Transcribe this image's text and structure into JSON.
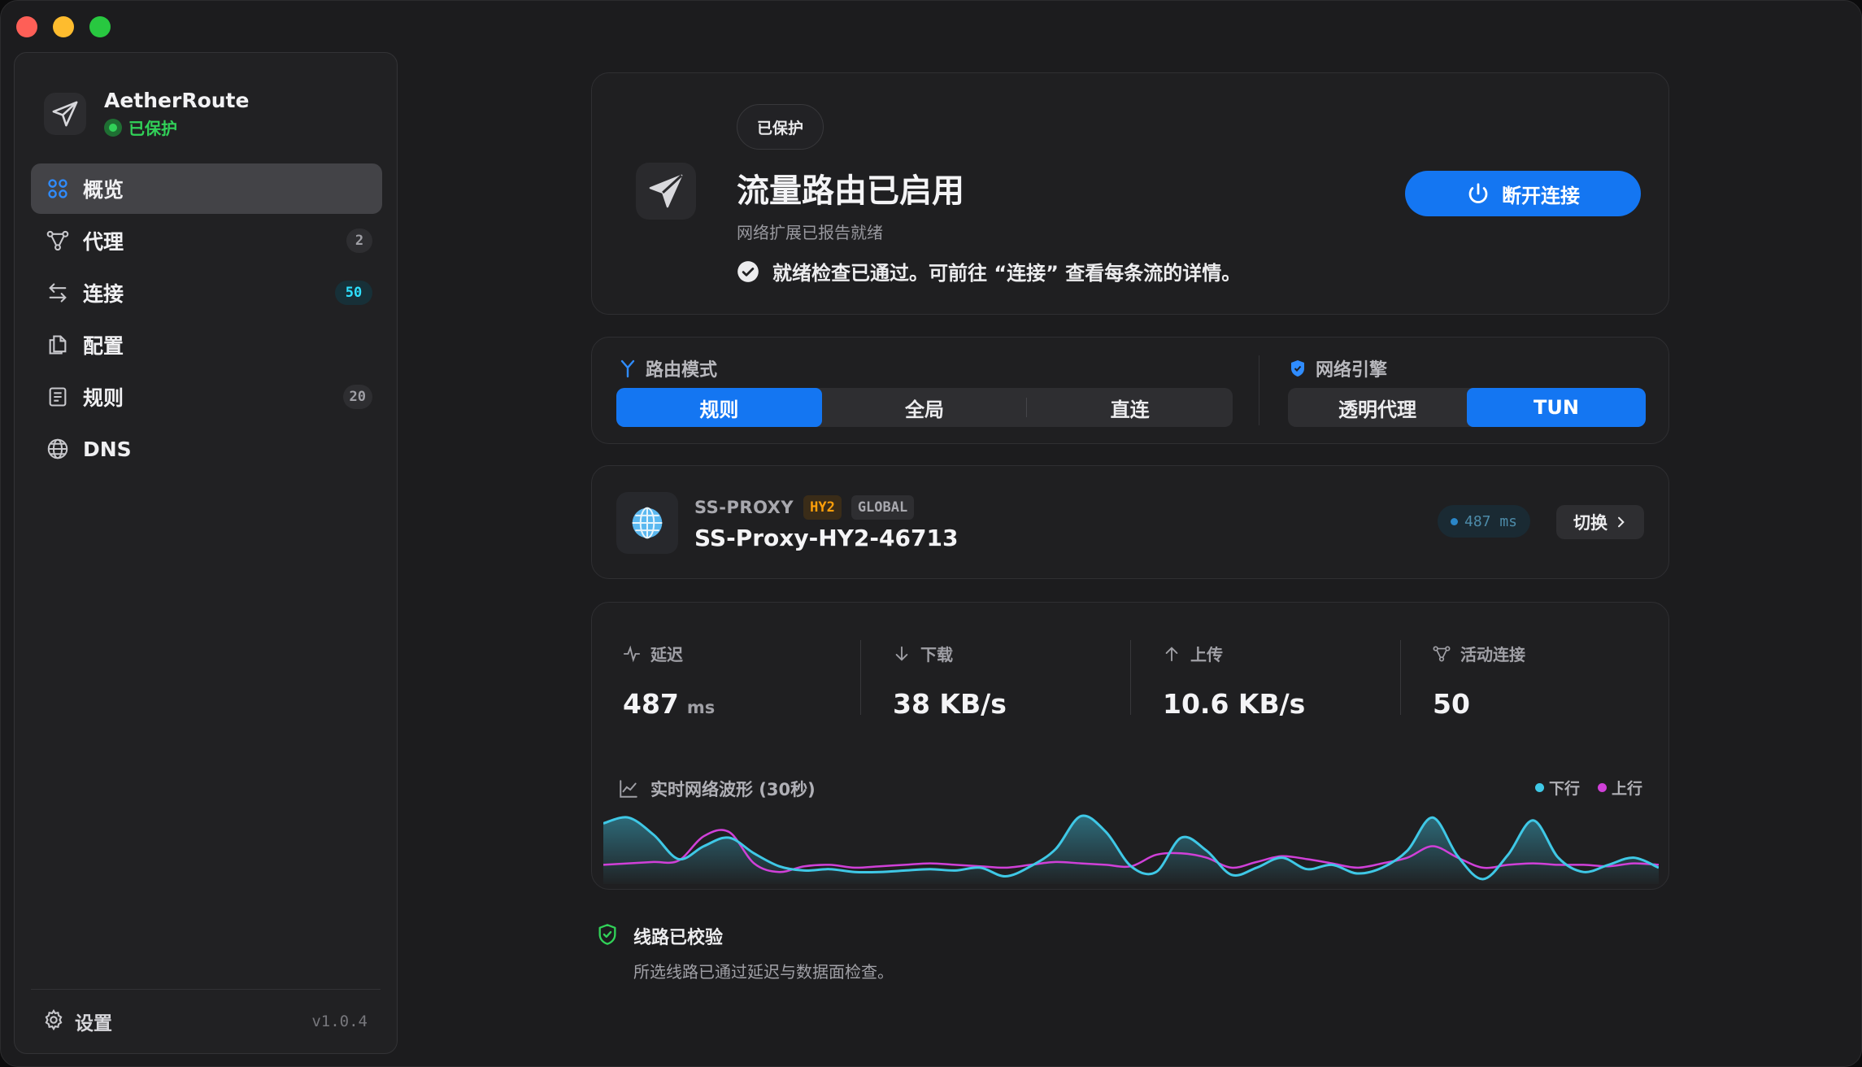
{
  "app": {
    "name": "AetherRoute",
    "status": "已保护",
    "version": "v1.0.4"
  },
  "sidebar": {
    "items": [
      {
        "label": "概览",
        "icon": "grid-icon",
        "badge": null,
        "active": true
      },
      {
        "label": "代理",
        "icon": "nodes-icon",
        "badge": "2"
      },
      {
        "label": "连接",
        "icon": "arrows-swap-icon",
        "badge": "50"
      },
      {
        "label": "配置",
        "icon": "files-icon",
        "badge": null
      },
      {
        "label": "规则",
        "icon": "list-icon",
        "badge": "20"
      },
      {
        "label": "DNS",
        "icon": "globe-icon",
        "badge": null
      }
    ],
    "settings_label": "设置"
  },
  "hero": {
    "pill": "已保护",
    "title": "流量路由已启用",
    "subtitle": "网络扩展已报告就绪",
    "check_text": "就绪检查已通过。可前往 “连接” 查看每条流的详情。",
    "disconnect_label": "断开连接"
  },
  "modes": {
    "routing_label": "路由模式",
    "routing_options": [
      "规则",
      "全局",
      "直连"
    ],
    "routing_selected": "规则",
    "engine_label": "网络引擎",
    "engine_options": [
      "透明代理",
      "TUN"
    ],
    "engine_selected": "TUN"
  },
  "proxy": {
    "type": "SS-PROXY",
    "tag_protocol": "HY2",
    "tag_scope": "GLOBAL",
    "name": "SS-Proxy-HY2-46713",
    "latency": "487 ms",
    "switch_label": "切换"
  },
  "stats": {
    "latency": {
      "label": "延迟",
      "value": "487",
      "unit": "ms"
    },
    "download": {
      "label": "下载",
      "value": "38 KB/s"
    },
    "upload": {
      "label": "上传",
      "value": "10.6 KB/s"
    },
    "connections": {
      "label": "活动连接",
      "value": "50"
    }
  },
  "wave": {
    "title": "实时网络波形 (30秒)",
    "legend_down": "下行",
    "legend_up": "上行",
    "color_down": "#3fc8e6",
    "color_up": "#d040d8",
    "down": [
      0.78,
      0.86,
      0.62,
      0.28,
      0.46,
      0.58,
      0.36,
      0.18,
      0.12,
      0.14,
      0.1,
      0.1,
      0.12,
      0.14,
      0.12,
      0.16,
      0.04,
      0.18,
      0.42,
      0.88,
      0.66,
      0.18,
      0.1,
      0.58,
      0.4,
      0.06,
      0.16,
      0.3,
      0.14,
      0.2,
      0.08,
      0.16,
      0.4,
      0.86,
      0.32,
      0.0,
      0.34,
      0.82,
      0.3,
      0.1,
      0.2,
      0.3,
      0.16
    ],
    "up": [
      0.2,
      0.22,
      0.24,
      0.26,
      0.6,
      0.66,
      0.22,
      0.1,
      0.18,
      0.2,
      0.16,
      0.18,
      0.2,
      0.22,
      0.2,
      0.18,
      0.16,
      0.2,
      0.24,
      0.22,
      0.2,
      0.18,
      0.34,
      0.36,
      0.3,
      0.16,
      0.24,
      0.32,
      0.28,
      0.22,
      0.16,
      0.22,
      0.3,
      0.46,
      0.3,
      0.16,
      0.2,
      0.22,
      0.2,
      0.2,
      0.18,
      0.22,
      0.2
    ]
  },
  "verified": {
    "title": "线路已校验",
    "desc": "所选线路已通过延迟与数据面检查。"
  }
}
